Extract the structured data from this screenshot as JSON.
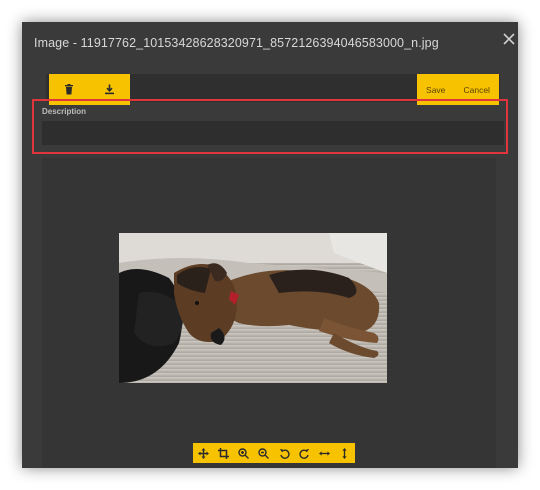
{
  "dialog": {
    "title": "Image - 11917762_10153428628320971_8572126394046583000_n.jpg"
  },
  "toolbar": {
    "delete_icon": "trash-icon",
    "download_icon": "download-icon",
    "save_label": "Save",
    "cancel_label": "Cancel"
  },
  "description": {
    "label": "Description",
    "value": "",
    "placeholder": ""
  },
  "image_tools": [
    {
      "name": "move-icon"
    },
    {
      "name": "crop-icon"
    },
    {
      "name": "zoom-in-icon"
    },
    {
      "name": "zoom-out-icon"
    },
    {
      "name": "rotate-left-icon"
    },
    {
      "name": "rotate-right-icon"
    },
    {
      "name": "flip-horizontal-icon"
    },
    {
      "name": "flip-vertical-icon"
    }
  ],
  "colors": {
    "accent": "#f7c300",
    "dialog_bg": "#3a3a3a",
    "highlight": "#e0353c"
  }
}
